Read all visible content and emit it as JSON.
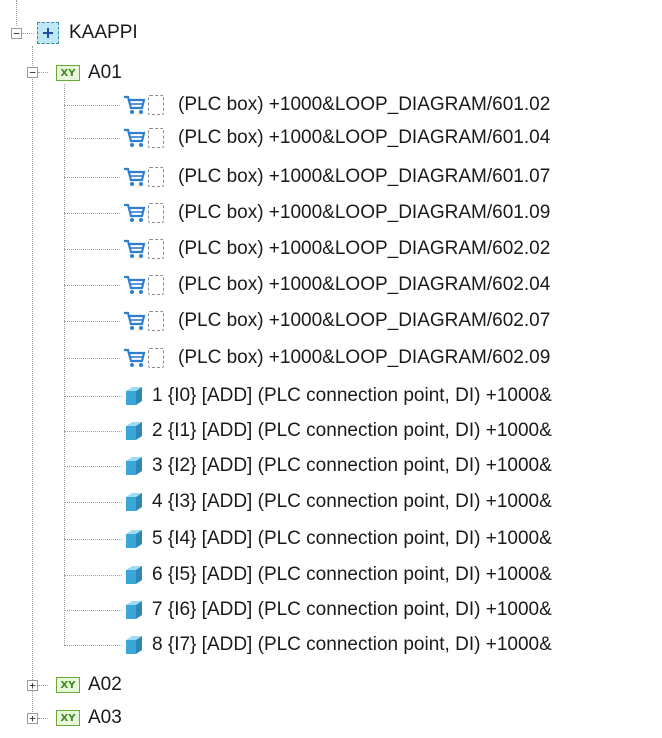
{
  "tree": {
    "root": {
      "label": "KAAPPI",
      "expanded": true
    },
    "groups": [
      {
        "label": "A01",
        "expanded": true,
        "plc_boxes": [
          "(PLC box) +1000&LOOP_DIAGRAM/601.02",
          "(PLC box) +1000&LOOP_DIAGRAM/601.04",
          "(PLC box) +1000&LOOP_DIAGRAM/601.07",
          "(PLC box) +1000&LOOP_DIAGRAM/601.09",
          "(PLC box) +1000&LOOP_DIAGRAM/602.02",
          "(PLC box) +1000&LOOP_DIAGRAM/602.04",
          "(PLC box) +1000&LOOP_DIAGRAM/602.07",
          "(PLC box) +1000&LOOP_DIAGRAM/602.09"
        ],
        "connection_points": [
          "1 {I0} [ADD] (PLC connection point, DI) +1000&",
          "2 {I1} [ADD] (PLC connection point, DI) +1000&",
          "3 {I2} [ADD] (PLC connection point, DI) +1000&",
          "4 {I3} [ADD] (PLC connection point, DI) +1000&",
          "5 {I4} [ADD] (PLC connection point, DI) +1000&",
          "6 {I5} [ADD] (PLC connection point, DI) +1000&",
          "7 {I6} [ADD] (PLC connection point, DI) +1000&",
          "8 {I7} [ADD] (PLC connection point, DI) +1000&"
        ]
      },
      {
        "label": "A02",
        "expanded": false
      },
      {
        "label": "A03",
        "expanded": false
      }
    ],
    "group_badge": "XY",
    "expander_expanded": "−",
    "expander_collapsed": "+",
    "icons": {
      "root": "plus-box-icon",
      "group": "xy-group-icon",
      "plc_box": "cart-icon",
      "placeholder": "dashed-box-icon",
      "connection_point": "cube-icon"
    },
    "colors": {
      "accent_blue": "#2f7fd0",
      "cube_blue": "#3aa7d8",
      "xy_green": "#3b8a1e"
    }
  }
}
